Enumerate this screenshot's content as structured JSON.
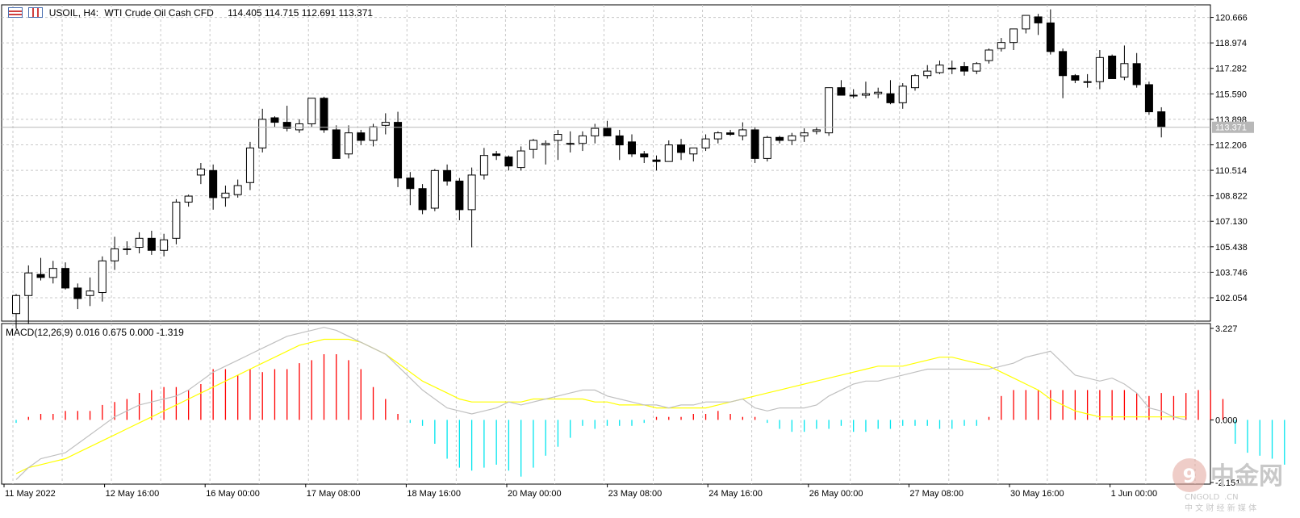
{
  "header": {
    "symbol": "USOIL, H4:",
    "description": "WTI Crude Oil Cash CFD",
    "ohlc": "114.405 114.715 112.691 113.371"
  },
  "macd_header": "MACD(12,26,9) 0.016 0.675 0.000 -1.319",
  "current_price_label": "113.371",
  "watermark": {
    "brand": "中金网",
    "brand_pinyin": "CNGOLD",
    "domain": ".CN",
    "tagline": "中 文 财 经 新 媒 体"
  },
  "colors": {
    "bull_body": "#ffffff",
    "bear_body": "#000000",
    "macd_positive": "#ff0000",
    "macd_negative": "#00e5ee",
    "signal_line": "#ffff00",
    "macd_line": "#c0c0c0"
  },
  "chart_data": [
    {
      "type": "candlestick",
      "title": "USOIL, H4: WTI Crude Oil Cash CFD",
      "y_ticks": [
        "120.666",
        "118.974",
        "117.282",
        "115.590",
        "113.898",
        "112.206",
        "110.514",
        "108.822",
        "107.130",
        "105.438",
        "103.746",
        "102.054"
      ],
      "x_ticks": [
        "11 May 2022",
        "12 May 16:00",
        "16 May 00:00",
        "17 May 08:00",
        "18 May 16:00",
        "20 May 00:00",
        "23 May 08:00",
        "24 May 16:00",
        "26 May 00:00",
        "27 May 08:00",
        "30 May 16:00",
        "1 Jun 00:00"
      ],
      "ylim": [
        100.5,
        121.5
      ],
      "current_price": 113.371,
      "grid": true,
      "ohlc": [
        [
          101.0,
          102.3,
          100.0,
          102.2
        ],
        [
          102.2,
          104.2,
          100.3,
          103.7
        ],
        [
          103.6,
          104.7,
          103.2,
          103.4
        ],
        [
          103.4,
          104.5,
          103.0,
          104.0
        ],
        [
          104.0,
          104.4,
          102.6,
          102.7
        ],
        [
          102.7,
          103.0,
          101.3,
          102.0
        ],
        [
          102.2,
          103.4,
          101.5,
          102.5
        ],
        [
          102.4,
          104.8,
          101.8,
          104.5
        ],
        [
          104.5,
          106.1,
          103.9,
          105.3
        ],
        [
          105.3,
          105.8,
          104.9,
          105.3
        ],
        [
          105.4,
          106.4,
          105.0,
          106.0
        ],
        [
          106.0,
          106.5,
          104.9,
          105.2
        ],
        [
          105.2,
          106.3,
          104.8,
          105.9
        ],
        [
          106.0,
          108.6,
          105.6,
          108.4
        ],
        [
          108.4,
          108.9,
          108.1,
          108.8
        ],
        [
          110.2,
          111.0,
          109.6,
          110.6
        ],
        [
          110.5,
          110.9,
          107.9,
          108.7
        ],
        [
          108.7,
          109.5,
          108.1,
          109.0
        ],
        [
          108.9,
          109.9,
          108.7,
          109.5
        ],
        [
          109.7,
          112.4,
          109.2,
          112.0
        ],
        [
          112.0,
          114.6,
          111.7,
          113.9
        ],
        [
          114.0,
          114.1,
          113.4,
          113.7
        ],
        [
          113.7,
          114.8,
          113.1,
          113.3
        ],
        [
          113.2,
          113.9,
          113.0,
          113.6
        ],
        [
          113.6,
          115.3,
          113.4,
          115.3
        ],
        [
          115.3,
          115.4,
          113.0,
          113.2
        ],
        [
          113.2,
          113.5,
          111.4,
          111.3
        ],
        [
          111.6,
          113.5,
          111.3,
          113.0
        ],
        [
          113.0,
          113.2,
          112.2,
          112.5
        ],
        [
          112.5,
          113.6,
          112.1,
          113.4
        ],
        [
          113.5,
          114.3,
          112.9,
          113.7
        ],
        [
          113.7,
          114.4,
          109.4,
          110.0
        ],
        [
          110.0,
          110.4,
          108.2,
          109.3
        ],
        [
          109.3,
          109.6,
          107.6,
          107.9
        ],
        [
          108.0,
          110.6,
          107.8,
          110.5
        ],
        [
          110.5,
          110.9,
          109.5,
          109.8
        ],
        [
          109.8,
          110.0,
          107.2,
          107.9
        ],
        [
          107.9,
          110.7,
          105.4,
          110.2
        ],
        [
          110.2,
          112.0,
          109.9,
          111.5
        ],
        [
          111.6,
          111.8,
          111.2,
          111.5
        ],
        [
          111.4,
          111.5,
          110.5,
          110.8
        ],
        [
          110.7,
          112.1,
          110.5,
          111.8
        ],
        [
          111.9,
          112.6,
          111.3,
          112.5
        ],
        [
          112.2,
          112.5,
          110.9,
          112.3
        ],
        [
          112.5,
          113.2,
          111.2,
          112.9
        ],
        [
          112.3,
          113.1,
          111.7,
          112.3
        ],
        [
          112.3,
          113.1,
          111.8,
          112.8
        ],
        [
          112.8,
          113.6,
          112.3,
          113.3
        ],
        [
          113.3,
          113.8,
          112.9,
          112.8
        ],
        [
          112.8,
          113.2,
          111.2,
          112.2
        ],
        [
          112.4,
          112.9,
          111.4,
          111.6
        ],
        [
          111.6,
          111.8,
          111.0,
          111.4
        ],
        [
          111.2,
          111.5,
          110.5,
          111.1
        ],
        [
          111.1,
          112.5,
          111.1,
          112.2
        ],
        [
          112.2,
          112.6,
          111.2,
          111.7
        ],
        [
          111.6,
          112.0,
          111.1,
          112.0
        ],
        [
          112.0,
          112.9,
          111.8,
          112.6
        ],
        [
          112.6,
          113.1,
          112.3,
          113.0
        ],
        [
          113.0,
          113.2,
          112.8,
          112.9
        ],
        [
          112.8,
          113.7,
          112.5,
          113.2
        ],
        [
          113.2,
          113.4,
          111.0,
          111.3
        ],
        [
          111.3,
          112.8,
          111.1,
          112.7
        ],
        [
          112.7,
          112.8,
          112.3,
          112.5
        ],
        [
          112.5,
          113.0,
          112.2,
          112.8
        ],
        [
          112.8,
          113.3,
          112.4,
          113.0
        ],
        [
          113.1,
          113.4,
          112.9,
          113.2
        ],
        [
          113.0,
          116.0,
          112.8,
          116.0
        ],
        [
          116.0,
          116.5,
          115.6,
          115.5
        ],
        [
          115.5,
          115.9,
          115.3,
          115.5
        ],
        [
          115.5,
          116.4,
          115.3,
          115.6
        ],
        [
          115.6,
          116.0,
          115.3,
          115.7
        ],
        [
          115.6,
          116.5,
          114.9,
          115.0
        ],
        [
          115.0,
          116.3,
          114.6,
          116.1
        ],
        [
          116.0,
          116.9,
          115.8,
          116.8
        ],
        [
          116.8,
          117.5,
          116.6,
          117.1
        ],
        [
          117.0,
          117.8,
          116.9,
          117.5
        ],
        [
          117.3,
          117.8,
          116.9,
          117.3
        ],
        [
          117.4,
          117.7,
          116.8,
          117.1
        ],
        [
          117.1,
          117.7,
          116.9,
          117.6
        ],
        [
          117.8,
          118.6,
          117.6,
          118.5
        ],
        [
          118.6,
          119.3,
          118.4,
          119.0
        ],
        [
          119.0,
          119.8,
          118.5,
          119.9
        ],
        [
          119.9,
          120.7,
          119.6,
          120.8
        ],
        [
          120.7,
          120.9,
          119.5,
          120.3
        ],
        [
          120.3,
          121.2,
          118.2,
          118.4
        ],
        [
          118.4,
          118.6,
          115.3,
          116.8
        ],
        [
          116.8,
          116.9,
          116.3,
          116.5
        ],
        [
          116.4,
          116.9,
          116.0,
          116.4
        ],
        [
          116.4,
          118.5,
          115.9,
          118.0
        ],
        [
          118.1,
          118.2,
          116.6,
          116.6
        ],
        [
          116.7,
          118.8,
          116.5,
          117.6
        ],
        [
          117.6,
          118.3,
          116.0,
          116.2
        ],
        [
          116.2,
          116.4,
          114.2,
          114.4
        ],
        [
          114.4,
          114.7,
          112.7,
          113.4
        ]
      ]
    },
    {
      "type": "bar",
      "title": "MACD(12,26,9)",
      "y_ticks": [
        "3.227",
        "0.000",
        "-2.151"
      ],
      "ylim": [
        -2.151,
        3.227
      ],
      "series": [
        {
          "name": "MACD histogram",
          "values": [
            -0.1,
            0.1,
            0.2,
            0.2,
            0.3,
            0.3,
            0.3,
            0.5,
            0.6,
            0.7,
            0.9,
            1.0,
            1.1,
            1.1,
            1.0,
            1.2,
            1.7,
            1.7,
            1.5,
            1.7,
            1.6,
            1.7,
            1.7,
            1.9,
            2.0,
            2.2,
            2.2,
            2.0,
            1.7,
            1.1,
            0.7,
            0.2,
            -0.1,
            -0.2,
            -0.8,
            -1.3,
            -1.6,
            -1.7,
            -1.6,
            -1.5,
            -1.7,
            -1.9,
            -1.6,
            -1.2,
            -0.9,
            -0.6,
            -0.2,
            -0.3,
            -0.2,
            -0.2,
            -0.2,
            -0.1,
            0.1,
            0.1,
            0.1,
            0.2,
            0.2,
            0.3,
            0.2,
            0.1,
            0.1,
            -0.1,
            -0.3,
            -0.4,
            -0.4,
            -0.3,
            -0.3,
            -0.2,
            -0.4,
            -0.4,
            -0.3,
            -0.3,
            -0.2,
            -0.2,
            -0.2,
            -0.3,
            -0.3,
            -0.2,
            -0.2,
            0.1,
            0.8,
            1.0,
            1.0,
            1.0,
            1.0,
            1.0,
            1.0,
            1.0,
            1.0,
            1.0,
            1.0,
            0.9,
            0.8,
            0.9,
            0.8,
            0.9,
            1.0,
            1.0,
            0.7,
            -0.8,
            -1.1,
            -1.2,
            -1.3,
            -1.5
          ]
        },
        {
          "name": "MACD line",
          "values": [
            -2.0,
            -1.6,
            -1.3,
            -1.2,
            -1.1,
            -0.8,
            -0.5,
            -0.2,
            0.1,
            0.3,
            0.5,
            0.6,
            0.7,
            0.8,
            1.0,
            1.3,
            1.6,
            1.8,
            2.0,
            2.2,
            2.4,
            2.6,
            2.8,
            2.9,
            3.0,
            3.1,
            3.0,
            2.8,
            2.6,
            2.4,
            2.2,
            1.8,
            1.4,
            1.0,
            0.7,
            0.4,
            0.3,
            0.2,
            0.3,
            0.4,
            0.6,
            0.5,
            0.6,
            0.7,
            0.8,
            0.9,
            1.0,
            1.0,
            0.8,
            0.7,
            0.6,
            0.5,
            0.5,
            0.4,
            0.5,
            0.5,
            0.6,
            0.6,
            0.6,
            0.7,
            0.4,
            0.3,
            0.4,
            0.4,
            0.4,
            0.5,
            0.8,
            1.0,
            1.2,
            1.3,
            1.3,
            1.4,
            1.5,
            1.6,
            1.7,
            1.7,
            1.7,
            1.7,
            1.7,
            1.7,
            1.8,
            1.9,
            2.1,
            2.2,
            2.3,
            1.9,
            1.5,
            1.4,
            1.3,
            1.4,
            1.2,
            0.9,
            0.4,
            0.3,
            0.1,
            0.0
          ]
        },
        {
          "name": "Signal line",
          "values": [
            -1.8,
            -1.6,
            -1.5,
            -1.4,
            -1.3,
            -1.1,
            -0.9,
            -0.7,
            -0.5,
            -0.3,
            -0.1,
            0.1,
            0.3,
            0.5,
            0.7,
            0.9,
            1.1,
            1.3,
            1.5,
            1.7,
            1.9,
            2.1,
            2.3,
            2.5,
            2.6,
            2.7,
            2.7,
            2.7,
            2.6,
            2.4,
            2.2,
            1.9,
            1.6,
            1.3,
            1.1,
            0.9,
            0.7,
            0.6,
            0.6,
            0.6,
            0.6,
            0.6,
            0.7,
            0.7,
            0.7,
            0.7,
            0.7,
            0.6,
            0.6,
            0.5,
            0.5,
            0.5,
            0.4,
            0.4,
            0.4,
            0.4,
            0.4,
            0.5,
            0.6,
            0.7,
            0.8,
            0.9,
            1.0,
            1.1,
            1.2,
            1.3,
            1.4,
            1.5,
            1.6,
            1.7,
            1.8,
            1.8,
            1.8,
            1.9,
            2.0,
            2.1,
            2.1,
            2.0,
            1.9,
            1.8,
            1.6,
            1.4,
            1.2,
            1.0,
            0.7,
            0.5,
            0.3,
            0.2,
            0.1,
            0.1,
            0.1,
            0.1,
            0.1,
            0.1,
            0.1,
            0.1
          ]
        }
      ]
    }
  ]
}
